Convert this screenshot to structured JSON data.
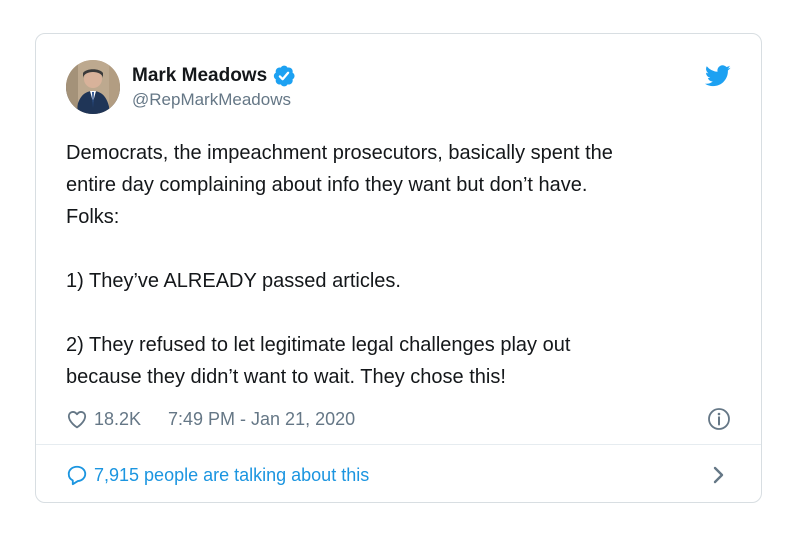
{
  "tweet": {
    "author": {
      "name": "Mark Meadows",
      "handle": "@RepMarkMeadows",
      "verified": true,
      "avatar_icon": "profile-photo-icon"
    },
    "brand_icon": "twitter-bird-icon",
    "text_lines_group_1": [
      "Democrats, the impeachment prosecutors, basically spent the",
      "entire day complaining about info they want but don’t have.",
      "Folks:"
    ],
    "text_lines_group_2": [
      "1) They’ve ALREADY passed articles."
    ],
    "text_lines_group_3": [
      "2) They refused to let legitimate legal challenges play out",
      "because they didn’t want to wait. They chose this!"
    ],
    "likes": "18.2K",
    "timestamp": "7:49 PM - Jan 21, 2020",
    "info_icon": "info-icon",
    "talking_about": "7,915 people are talking about this"
  },
  "colors": {
    "text": "#14171a",
    "muted": "#657786",
    "accent": "#1b95e0",
    "border": "#d8dee2"
  }
}
